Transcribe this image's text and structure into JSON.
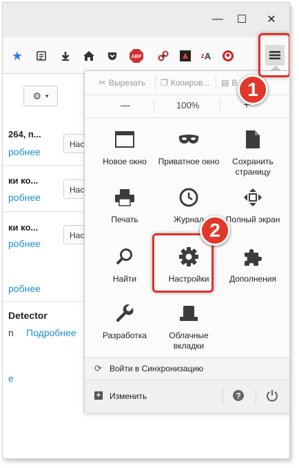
{
  "window": {
    "minimize": "—",
    "maximize": "☐",
    "close": "✕"
  },
  "toolbar": {
    "abp_label": "ABP",
    "translate_label": "A"
  },
  "page": {
    "gear_caret": "▾",
    "rows": [
      {
        "title": "264, п...",
        "link": "робнее",
        "button": "Нас"
      },
      {
        "title": "ки ко...",
        "link": "робнее",
        "button": "Нас"
      },
      {
        "title": "ки ко...",
        "link": "робнее",
        "button": "Нас"
      },
      {
        "title": "",
        "link": "робнее",
        "button": ""
      },
      {
        "title": "Detector",
        "link": "",
        "button": ""
      }
    ],
    "detector_prefix": "n",
    "detector_link": "Подробнее",
    "last_link": "е"
  },
  "menu": {
    "cut": "Вырезать",
    "copy": "Копиров...",
    "paste": "В",
    "zoom_out": "—",
    "zoom_level": "100%",
    "zoom_in": "+",
    "items": [
      {
        "label": "Новое окно",
        "icon": "window-icon"
      },
      {
        "label": "Приватное окно",
        "icon": "mask-icon"
      },
      {
        "label": "Сохранить страницу",
        "icon": "page-icon"
      },
      {
        "label": "Печать",
        "icon": "printer-icon"
      },
      {
        "label": "Журнал",
        "icon": "clock-icon"
      },
      {
        "label": "Полный экран",
        "icon": "fullscreen-icon"
      },
      {
        "label": "Найти",
        "icon": "search-icon"
      },
      {
        "label": "Настройки",
        "icon": "gear-icon"
      },
      {
        "label": "Дополнения",
        "icon": "puzzle-icon"
      },
      {
        "label": "Разработка",
        "icon": "wrench-icon"
      },
      {
        "label": "Облачные вкладки",
        "icon": "cloud-tabs-icon"
      }
    ],
    "sync": "Войти в Синхронизацию",
    "customize": "Изменить"
  },
  "annotations": {
    "step1": "1",
    "step2": "2",
    "highlight_color": "#e0312b"
  }
}
